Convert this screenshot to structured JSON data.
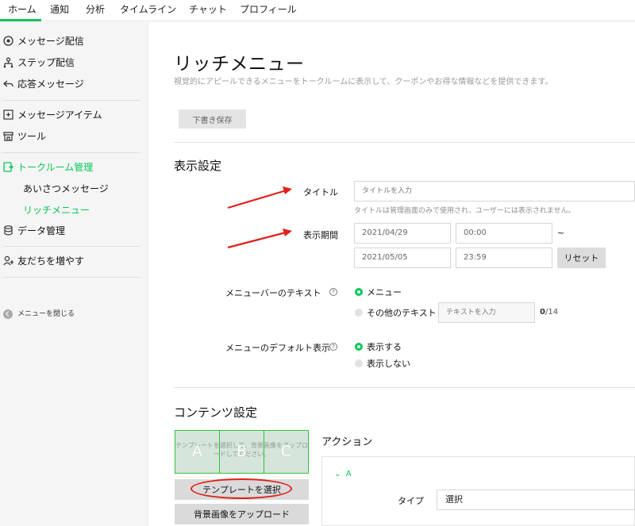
{
  "nav": {
    "tabs": [
      "ホーム",
      "通知",
      "分析",
      "タイムライン",
      "チャット",
      "プロフィール"
    ],
    "active": "ホーム"
  },
  "sidebar": {
    "items": [
      {
        "label": "メッセージ配信",
        "icon": "broadcast-icon"
      },
      {
        "label": "ステップ配信",
        "icon": "step-icon"
      },
      {
        "label": "応答メッセージ",
        "icon": "reply-icon"
      },
      {
        "label": "メッセージアイテム",
        "icon": "plus-box-icon"
      },
      {
        "label": "ツール",
        "icon": "store-icon"
      },
      {
        "label": "トークルーム管理",
        "icon": "talkroom-icon"
      },
      {
        "label": "データ管理",
        "icon": "database-icon"
      },
      {
        "label": "友だちを増やす",
        "icon": "add-friend-icon"
      }
    ],
    "subitems": [
      "あいさつメッセージ",
      "リッチメニュー"
    ],
    "close_label": "メニューを閉じる",
    "accent": "#06c755"
  },
  "page": {
    "title": "リッチメニュー",
    "description": "視覚的にアピールできるメニューをトークルームに表示して、クーポンやお得な情報などを提供できます。",
    "draft_button": "下書き保存"
  },
  "display": {
    "section_title": "表示設定",
    "title_label": "タイトル",
    "title_placeholder": "タイトルを入力",
    "title_hint": "タイトルは管理画面のみで使用され、ユーザーには表示されません。",
    "period_label": "表示期間",
    "start_date": "2021/04/29",
    "start_time": "00:00",
    "tilde": "~",
    "end_date": "2021/05/05",
    "end_time": "23:59",
    "reset_button": "リセット",
    "menubar_label": "メニューバーのテキスト",
    "menubar_option1": "メニュー",
    "menubar_option2": "その他のテキスト",
    "menubar_text_placeholder": "テキストを入力",
    "menubar_counter": "0",
    "menubar_counter_max": "/14",
    "default_label": "メニューのデフォルト表示",
    "default_option1": "表示する",
    "default_option2": "表示しない",
    "help_glyph": "?"
  },
  "content": {
    "section_title": "コンテンツ設定",
    "template_placeholder": "テンプレートを選択して、背景画像をアップロードしてください。",
    "cells": [
      "A",
      "B",
      "C"
    ],
    "template_button": "テンプレートを選択",
    "upload_button": "背景画像をアップロード",
    "action_title": "アクション",
    "action_a": "A",
    "type_label": "タイプ",
    "type_value": "選択",
    "annotation_color": "#e0211c"
  }
}
